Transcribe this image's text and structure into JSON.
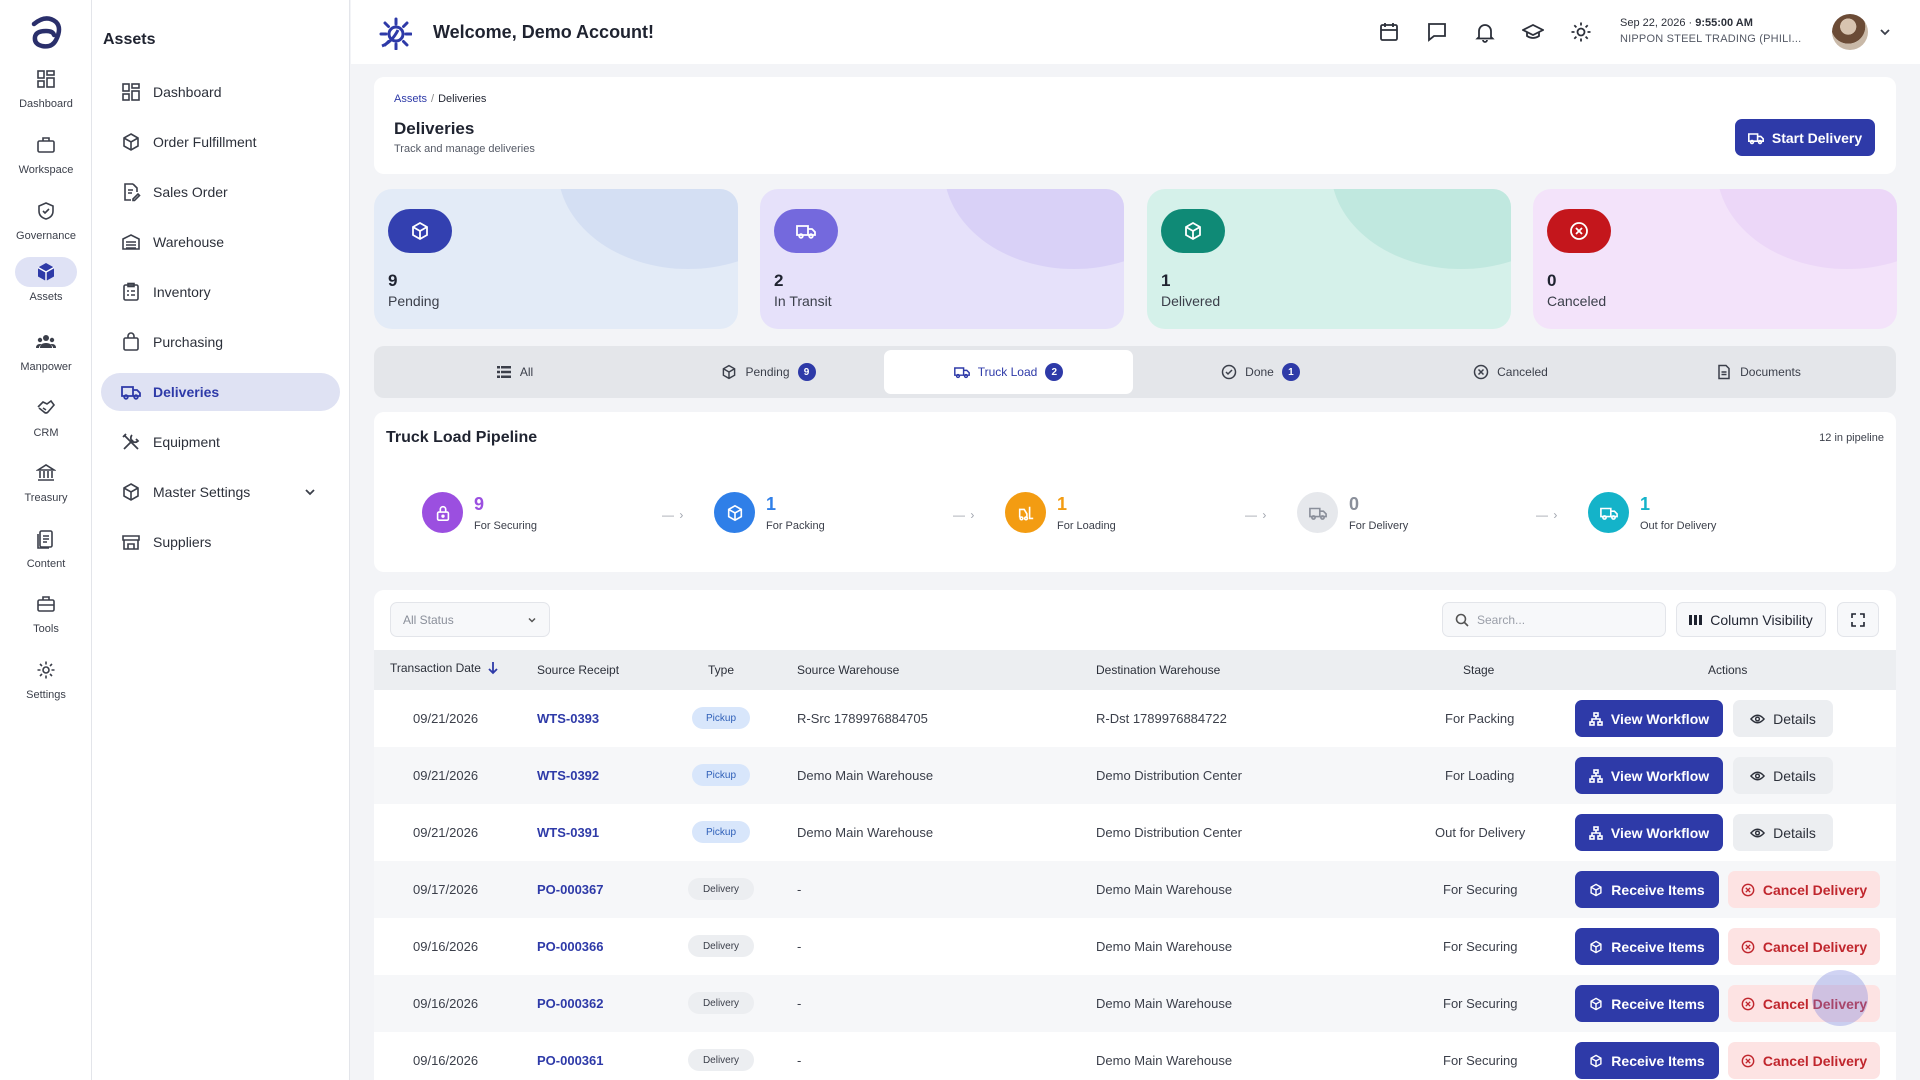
{
  "rail": {
    "items": [
      {
        "label": "Dashboard",
        "icon": "dashboard-icon"
      },
      {
        "label": "Workspace",
        "icon": "briefcase-icon"
      },
      {
        "label": "Governance",
        "icon": "shield-icon"
      },
      {
        "label": "Assets",
        "icon": "cube-icon"
      },
      {
        "label": "Manpower",
        "icon": "people-icon"
      },
      {
        "label": "CRM",
        "icon": "handshake-icon"
      },
      {
        "label": "Treasury",
        "icon": "bank-icon"
      },
      {
        "label": "Content",
        "icon": "document-icon"
      },
      {
        "label": "Tools",
        "icon": "toolbox-icon"
      },
      {
        "label": "Settings",
        "icon": "gear-icon"
      }
    ],
    "active": "Assets"
  },
  "sidebar": {
    "title": "Assets",
    "items": [
      {
        "label": "Dashboard"
      },
      {
        "label": "Order Fulfillment"
      },
      {
        "label": "Sales Order"
      },
      {
        "label": "Warehouse"
      },
      {
        "label": "Inventory"
      },
      {
        "label": "Purchasing"
      },
      {
        "label": "Deliveries"
      },
      {
        "label": "Equipment"
      },
      {
        "label": "Master Settings"
      },
      {
        "label": "Suppliers"
      }
    ],
    "active": "Deliveries"
  },
  "header": {
    "welcome": "Welcome, Demo Account!",
    "date": "Sep 22, 2026",
    "time": "9:55:00 AM",
    "org": "NIPPON STEEL TRADING (PHILI..."
  },
  "page": {
    "breadcrumb_root": "Assets",
    "breadcrumb_current": "Deliveries",
    "title": "Deliveries",
    "subtitle": "Track and manage deliveries",
    "start_button": "Start Delivery"
  },
  "stats": [
    {
      "value": "9",
      "label": "Pending",
      "color": "#3340b0"
    },
    {
      "value": "2",
      "label": "In Transit",
      "color": "#7469dd"
    },
    {
      "value": "1",
      "label": "Delivered",
      "color": "#0f8a76"
    },
    {
      "value": "0",
      "label": "Canceled",
      "color": "#c4161c"
    }
  ],
  "tabs": [
    {
      "label": "All",
      "badge": ""
    },
    {
      "label": "Pending",
      "badge": "9"
    },
    {
      "label": "Truck Load",
      "badge": "2"
    },
    {
      "label": "Done",
      "badge": "1"
    },
    {
      "label": "Canceled",
      "badge": ""
    },
    {
      "label": "Documents",
      "badge": ""
    }
  ],
  "active_tab": "Truck Load",
  "pipeline": {
    "title": "Truck Load Pipeline",
    "count": "12 in pipeline",
    "stages": [
      {
        "value": "9",
        "label": "For Securing",
        "color": "#9b4fe0"
      },
      {
        "value": "1",
        "label": "For Packing",
        "color": "#2f7fe8"
      },
      {
        "value": "1",
        "label": "For Loading",
        "color": "#f39c12"
      },
      {
        "value": "0",
        "label": "For Delivery",
        "color": "#8a8f9a"
      },
      {
        "value": "1",
        "label": "Out for Delivery",
        "color": "#14b3c9"
      }
    ]
  },
  "table": {
    "filter_value": "All Status",
    "search_placeholder": "Search...",
    "column_visibility": "Column Visibility",
    "headers": [
      "Transaction Date",
      "Source Receipt",
      "Type",
      "Source Warehouse",
      "Destination Warehouse",
      "Stage",
      "Actions"
    ],
    "rows": [
      {
        "date": "09/21/2026",
        "receipt": "WTS-0393",
        "type": "Pickup",
        "source": "R-Src 1789976884705",
        "dest": "R-Dst 1789976884722",
        "stage": "For Packing",
        "action1": "View Workflow",
        "action2": "Details"
      },
      {
        "date": "09/21/2026",
        "receipt": "WTS-0392",
        "type": "Pickup",
        "source": "Demo Main Warehouse",
        "dest": "Demo Distribution Center",
        "stage": "For Loading",
        "action1": "View Workflow",
        "action2": "Details"
      },
      {
        "date": "09/21/2026",
        "receipt": "WTS-0391",
        "type": "Pickup",
        "source": "Demo Main Warehouse",
        "dest": "Demo Distribution Center",
        "stage": "Out for Delivery",
        "action1": "View Workflow",
        "action2": "Details"
      },
      {
        "date": "09/17/2026",
        "receipt": "PO-000367",
        "type": "Delivery",
        "source": "-",
        "dest": "Demo Main Warehouse",
        "stage": "For Securing",
        "action1": "Receive Items",
        "action2": "Cancel Delivery"
      },
      {
        "date": "09/16/2026",
        "receipt": "PO-000366",
        "type": "Delivery",
        "source": "-",
        "dest": "Demo Main Warehouse",
        "stage": "For Securing",
        "action1": "Receive Items",
        "action2": "Cancel Delivery"
      },
      {
        "date": "09/16/2026",
        "receipt": "PO-000362",
        "type": "Delivery",
        "source": "-",
        "dest": "Demo Main Warehouse",
        "stage": "For Securing",
        "action1": "Receive Items",
        "action2": "Cancel Delivery"
      },
      {
        "date": "09/16/2026",
        "receipt": "PO-000361",
        "type": "Delivery",
        "source": "-",
        "dest": "Demo Main Warehouse",
        "stage": "For Securing",
        "action1": "Receive Items",
        "action2": "Cancel Delivery"
      }
    ]
  },
  "colors": {
    "primary": "#2e3aa8",
    "danger": "#c0262d",
    "danger_bg": "#fde3e3"
  }
}
